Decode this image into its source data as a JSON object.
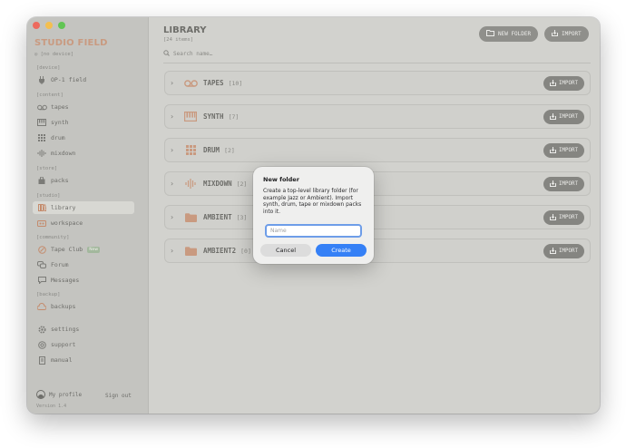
{
  "sidebar": {
    "brand": "STUDIO FIELD",
    "device_status": "[no device]",
    "sections": {
      "device": "[device]",
      "content": "[content]",
      "store": "[store]",
      "studio": "[studio]",
      "community": "[community]",
      "backup": "[backup]"
    },
    "items": {
      "op1": "OP-1 field",
      "tapes": "tapes",
      "synth": "synth",
      "drum": "drum",
      "mixdown": "mixdown",
      "packs": "packs",
      "library": "library",
      "workspace": "workspace",
      "tape_club": "Tape Club",
      "tape_club_badge": "New",
      "forum": "Forum",
      "messages": "Messages",
      "backups": "backups",
      "settings": "settings",
      "support": "support",
      "manual": "manual"
    },
    "profile": "My profile",
    "sign_out": "Sign out",
    "version": "Version 1.4"
  },
  "header": {
    "title": "LIBRARY",
    "count": "[24 items]",
    "new_folder": "NEW FOLDER",
    "import": "IMPORT",
    "search_placeholder": "Search name…"
  },
  "library": {
    "import_label": "IMPORT",
    "rows": [
      {
        "name": "TAPES",
        "count": "[10]",
        "icon": "tape-icon"
      },
      {
        "name": "SYNTH",
        "count": "[7]",
        "icon": "keyboard-icon"
      },
      {
        "name": "DRUM",
        "count": "[2]",
        "icon": "drum-grid-icon"
      },
      {
        "name": "MIXDOWN",
        "count": "[2]",
        "icon": "waveform-icon"
      },
      {
        "name": "AMBIENT",
        "count": "[3]",
        "icon": "folder-icon"
      },
      {
        "name": "AMBIENT2",
        "count": "[0]",
        "icon": "folder-icon"
      }
    ]
  },
  "dialog": {
    "title": "New folder",
    "body": "Create a top-level library folder (for example Jazz or Ambient). Import synth, drum, tape or mixdown packs into it.",
    "placeholder": "Name",
    "value": "",
    "cancel": "Cancel",
    "create": "Create"
  },
  "colors": {
    "accent": "#c99a80",
    "primary_button": "#3580f6",
    "badge": "#a3b89d"
  }
}
